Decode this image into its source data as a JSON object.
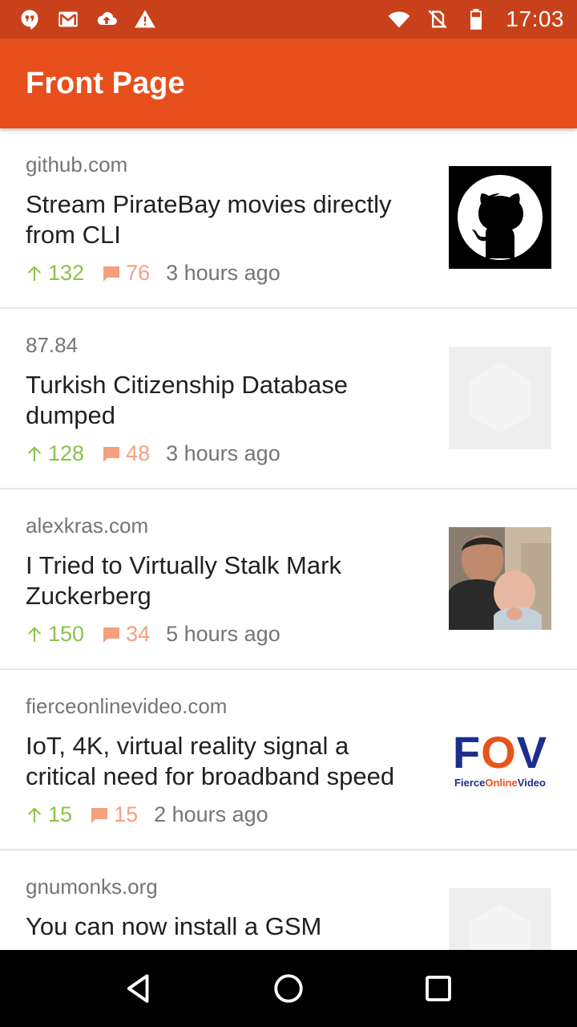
{
  "status_bar": {
    "time": "17:03",
    "left_icons": [
      "hangouts-icon",
      "gmail-icon",
      "cloud-upload-icon",
      "warning-icon"
    ],
    "right_icons": [
      "wifi-icon",
      "no-sim-icon",
      "battery-icon"
    ]
  },
  "app_bar": {
    "title": "Front Page",
    "background": "#e64f1c",
    "status_background": "#c9411b"
  },
  "stories": [
    {
      "domain": "github.com",
      "title": "Stream PirateBay movies directly from CLI",
      "points": "132",
      "comments": "76",
      "time": "3 hours ago",
      "thumbnail": "github-logo"
    },
    {
      "domain": "87.84",
      "title": "Turkish Citizenship Database dumped",
      "points": "128",
      "comments": "48",
      "time": "3 hours ago",
      "thumbnail": "placeholder"
    },
    {
      "domain": "alexkras.com",
      "title": "I Tried to Virtually Stalk Mark Zuckerberg",
      "points": "150",
      "comments": "34",
      "time": "5 hours ago",
      "thumbnail": "photo"
    },
    {
      "domain": "fierceonlinevideo.com",
      "title": "IoT, 4K, virtual reality signal a critical need for broadband speed",
      "points": "15",
      "comments": "15",
      "time": "2 hours ago",
      "thumbnail": "fov-logo"
    },
    {
      "domain": "gnumonks.org",
      "title": "You can now install a GSM",
      "points": "",
      "comments": "",
      "time": "",
      "thumbnail": "placeholder"
    }
  ],
  "fov_logo": {
    "big_prefix": "F",
    "big_o": "O",
    "big_suffix": "V",
    "small_prefix": "Fierce",
    "small_o": "Online",
    "small_suffix": "Video"
  },
  "colors": {
    "points": "#8bc34a",
    "comments": "#f4a07f",
    "meta_text": "#757575"
  },
  "nav_bar": {
    "buttons": [
      "back-icon",
      "home-icon",
      "recents-icon"
    ]
  }
}
